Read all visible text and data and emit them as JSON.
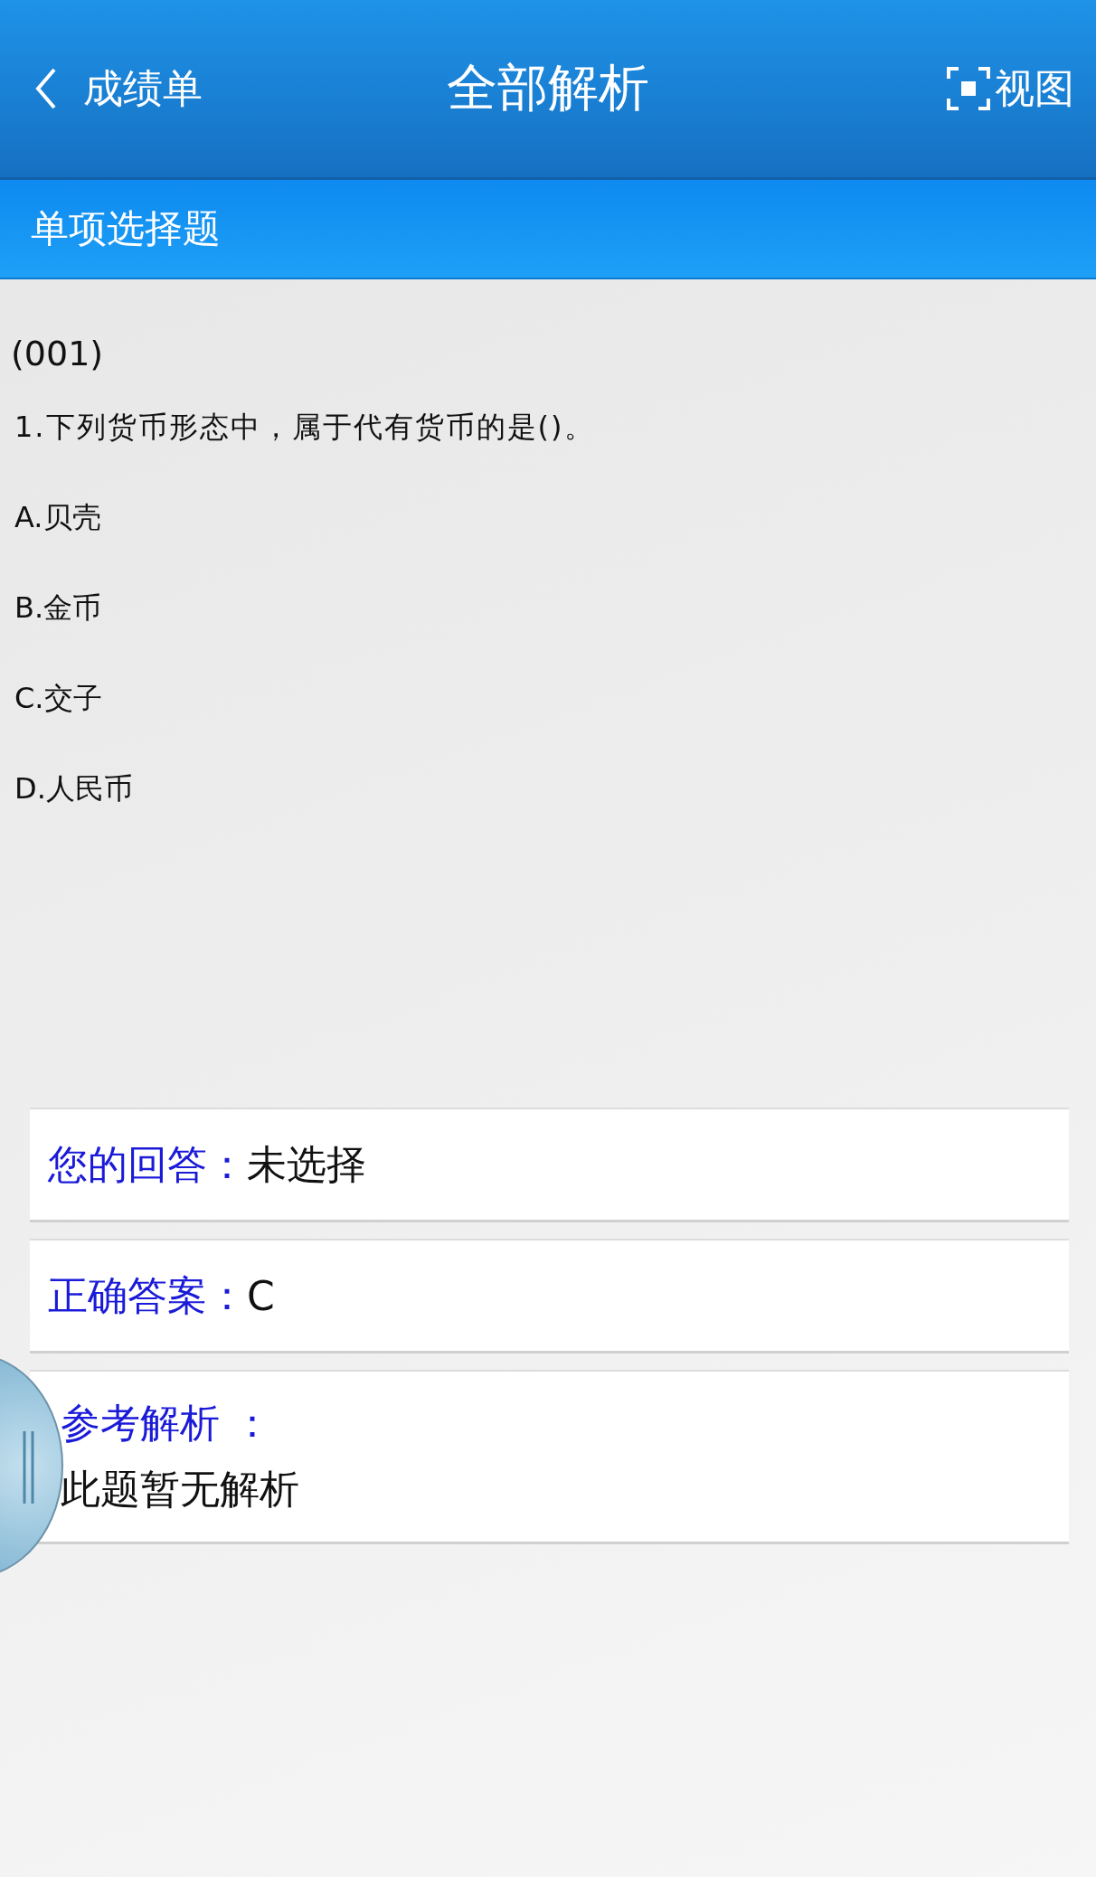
{
  "header": {
    "back_label": "成绩单",
    "title": "全部解析",
    "view_label": "视图"
  },
  "section": {
    "title": "单项选择题"
  },
  "question": {
    "number": "(001)",
    "text": "1.下列货币形态中，属于代有货币的是()。",
    "options": [
      "A.贝壳",
      "B.金币",
      "C.交子",
      "D.人民币"
    ]
  },
  "results": [
    {
      "kind": "inline",
      "label": "您的回答：",
      "value": "未选择"
    },
    {
      "kind": "inline",
      "label": "正确答案：",
      "value": "C"
    },
    {
      "kind": "block",
      "label": "参考解析 ：",
      "value": "此题暂无解析"
    }
  ]
}
